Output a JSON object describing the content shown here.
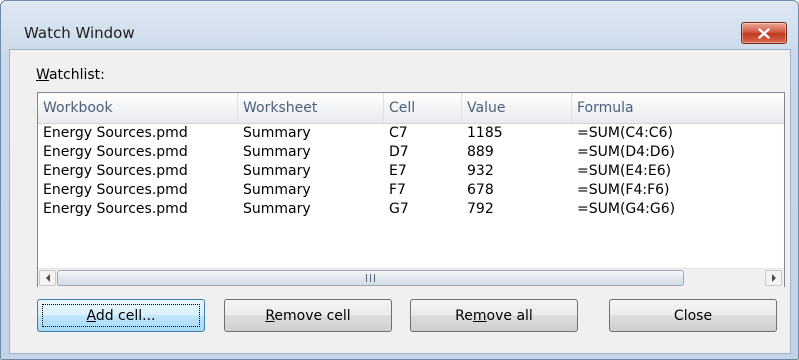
{
  "window": {
    "title": "Watch Window",
    "close_icon": "close-x-icon",
    "close_color": "#c8412a"
  },
  "watchlist": {
    "label_accesskey": "W",
    "label_rest": "atchlist:"
  },
  "columns": [
    "Workbook",
    "Worksheet",
    "Cell",
    "Value",
    "Formula"
  ],
  "rows": [
    {
      "workbook": "Energy Sources.pmd",
      "worksheet": "Summary",
      "cell": "C7",
      "value": "1185",
      "formula": "=SUM(C4:C6)"
    },
    {
      "workbook": "Energy Sources.pmd",
      "worksheet": "Summary",
      "cell": "D7",
      "value": "889",
      "formula": "=SUM(D4:D6)"
    },
    {
      "workbook": "Energy Sources.pmd",
      "worksheet": "Summary",
      "cell": "E7",
      "value": "932",
      "formula": "=SUM(E4:E6)"
    },
    {
      "workbook": "Energy Sources.pmd",
      "worksheet": "Summary",
      "cell": "F7",
      "value": "678",
      "formula": "=SUM(F4:F6)"
    },
    {
      "workbook": "Energy Sources.pmd",
      "worksheet": "Summary",
      "cell": "G7",
      "value": "792",
      "formula": "=SUM(G4:G6)"
    }
  ],
  "scrollbar": {
    "left_icon": "arrow-left-icon",
    "right_icon": "arrow-right-icon",
    "grip_icon": "scroll-grip-icon"
  },
  "buttons": {
    "add_cell": {
      "accesskey": "A",
      "rest": "dd cell..."
    },
    "remove_cell": {
      "accesskey": "R",
      "rest": "emove cell"
    },
    "remove_all": {
      "pre": "Re",
      "accesskey": "m",
      "rest": "ove all"
    },
    "close": {
      "label": "Close"
    }
  }
}
